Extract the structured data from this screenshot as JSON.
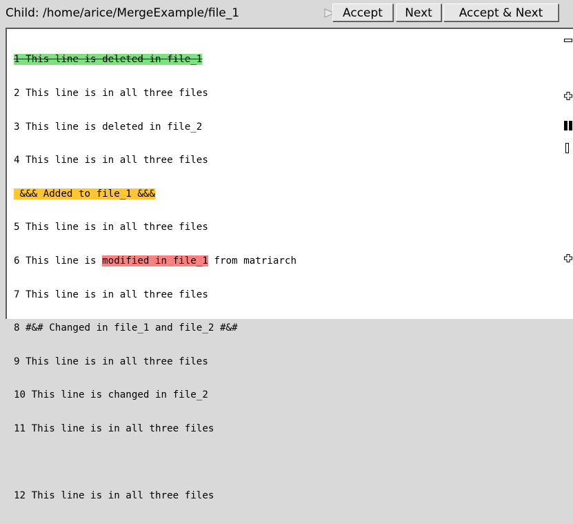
{
  "header": {
    "path": "Child: /home/arice/MergeExample/file_1",
    "accept_label": "Accept",
    "next_label": "Next",
    "accept_next_label": "Accept & Next"
  },
  "lines": {
    "l1": "1 This line is deleted in file_1",
    "l2": "2 This line is in all three files",
    "l3": "3 This line is deleted in file_2",
    "l4": "4 This line is in all three files",
    "added": " &&& Added to file_1 &&&",
    "l5": "5 This line is in all three files",
    "l6_prefix": "6 This line is ",
    "l6_highlight": "modified in file_1",
    "l6_suffix": " from matriarch",
    "l7": "7 This line is in all three files",
    "l8": "8 #&# Changed in file_1 and file_2 #&#",
    "l9": "9 This line is in all three files",
    "l10": "10 This line is changed in file_2",
    "l11": "11 This line is in all three files",
    "blank": " ",
    "l12": "12 This line is in all three files"
  },
  "colors": {
    "deleted": "#7ee07e",
    "added": "#ffc533",
    "modified": "#ff8080"
  },
  "icons": [
    "arrow-right-icon",
    "minus-marker-icon",
    "plus-marker-icon",
    "block-marker-icon",
    "bracket-marker-icon"
  ]
}
